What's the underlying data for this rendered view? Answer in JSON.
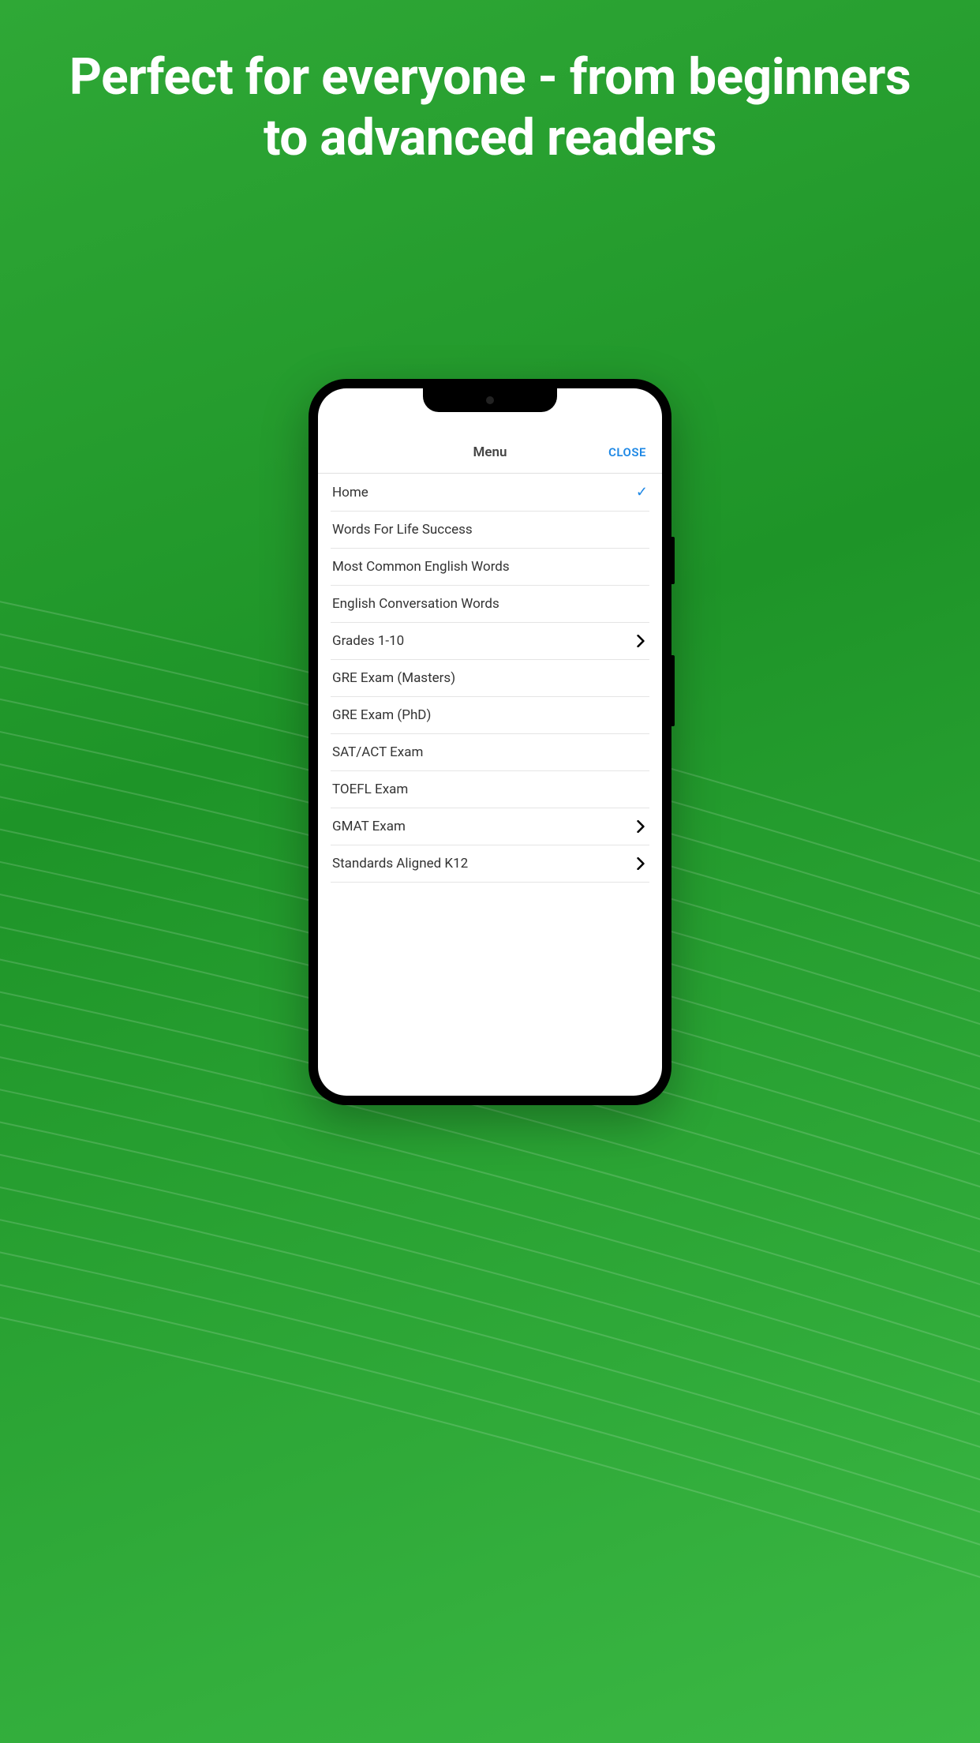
{
  "headline": "Perfect for everyone - from beginners to advanced readers",
  "menu": {
    "title": "Menu",
    "close_label": "CLOSE",
    "items": [
      {
        "label": "Home",
        "selected": true,
        "has_submenu": false
      },
      {
        "label": "Words For Life Success",
        "selected": false,
        "has_submenu": false
      },
      {
        "label": "Most Common English Words",
        "selected": false,
        "has_submenu": false
      },
      {
        "label": "English Conversation Words",
        "selected": false,
        "has_submenu": false
      },
      {
        "label": "Grades 1-10",
        "selected": false,
        "has_submenu": true
      },
      {
        "label": "GRE Exam (Masters)",
        "selected": false,
        "has_submenu": false
      },
      {
        "label": "GRE Exam (PhD)",
        "selected": false,
        "has_submenu": false
      },
      {
        "label": "SAT/ACT Exam",
        "selected": false,
        "has_submenu": false
      },
      {
        "label": "TOEFL Exam",
        "selected": false,
        "has_submenu": false
      },
      {
        "label": "GMAT Exam",
        "selected": false,
        "has_submenu": true
      },
      {
        "label": "Standards Aligned K12",
        "selected": false,
        "has_submenu": true
      }
    ]
  }
}
